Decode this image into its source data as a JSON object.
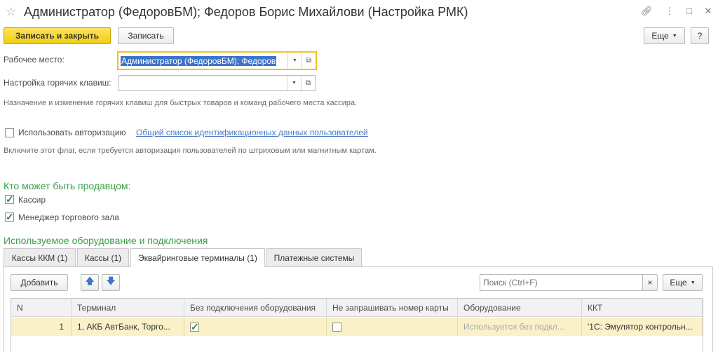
{
  "window": {
    "title": "Администратор (ФедоровБМ); Федоров Борис Михайлови (Настройка РМК)",
    "icons": [
      "star-icon",
      "link-icon",
      "more-icon",
      "maximize-icon",
      "close-icon"
    ]
  },
  "toolbar": {
    "save_close_label": "Записать и закрыть",
    "save_label": "Записать",
    "more_label": "Еще",
    "help_label": "?"
  },
  "form": {
    "workplace_label": "Рабочее место:",
    "workplace_value": "Администратор (ФедоровБМ); Федоров",
    "hotkeys_label": "Настройка горячих клавиш:",
    "hotkeys_value": "",
    "hotkeys_hint": "Назначение и изменение горячих клавиш для быстрых товаров и команд рабочего места кассира.",
    "use_auth_label": "Использовать авторизацию",
    "use_auth_checked": false,
    "auth_link": "Общий список идентификационных данных пользователей",
    "auth_hint": "Включите этот флаг, если требуется авторизация пользователей по штриховым или магнитным картам."
  },
  "sellers": {
    "title": "Кто может быть продавцом:",
    "items": [
      {
        "label": "Кассир",
        "checked": true
      },
      {
        "label": "Менеджер торгового зала",
        "checked": true
      }
    ]
  },
  "equipment": {
    "title": "Используемое оборудование и подключения",
    "tabs": [
      {
        "label": "Кассы ККМ (1)",
        "active": false
      },
      {
        "label": "Кассы (1)",
        "active": false
      },
      {
        "label": "Эквайринговые терминалы (1)",
        "active": true
      },
      {
        "label": "Платежные системы",
        "active": false
      }
    ],
    "add_label": "Добавить",
    "search_placeholder": "Поиск (Ctrl+F)",
    "clear_label": "×",
    "more_label": "Еще",
    "columns": [
      "N",
      "Терминал",
      "Без подключения оборудования",
      "Не запрашивать номер карты",
      "Оборудование",
      "ККТ"
    ],
    "rows": [
      {
        "n": "1",
        "terminal": "1, АКБ АвтБанк, Торго...",
        "no_equipment": true,
        "no_card_number": false,
        "equipment": "Используется без подкл...",
        "kkt": "'1С: Эмулятор контрольн..."
      }
    ]
  },
  "colors": {
    "primary_button": "#f2cd12",
    "section_title": "#3a9f45",
    "link": "#4a79c4",
    "selected_row": "#faf1c9",
    "focus_border": "#f0c419"
  }
}
